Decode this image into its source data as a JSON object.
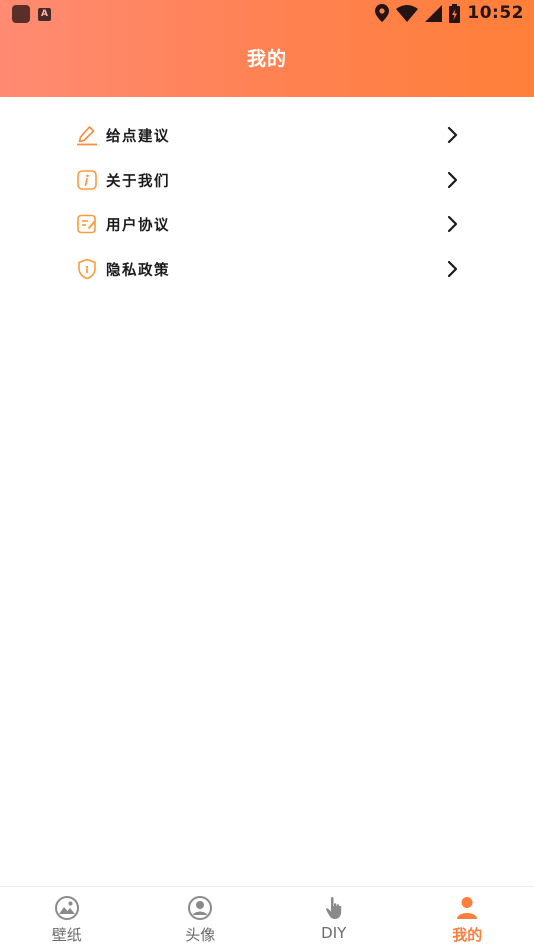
{
  "status_bar": {
    "time": "10:52",
    "app_badge": "A"
  },
  "header": {
    "title": "我的"
  },
  "menu": {
    "items": [
      {
        "label": "给点建议",
        "icon": "pencil-icon"
      },
      {
        "label": "关于我们",
        "icon": "info-icon"
      },
      {
        "label": "用户协议",
        "icon": "document-edit-icon"
      },
      {
        "label": "隐私政策",
        "icon": "shield-icon"
      }
    ]
  },
  "tabbar": {
    "tabs": [
      {
        "label": "壁纸",
        "icon": "wallpaper-icon",
        "active": false
      },
      {
        "label": "头像",
        "icon": "avatar-icon",
        "active": false
      },
      {
        "label": "DIY",
        "icon": "hand-pointer-icon",
        "active": false
      },
      {
        "label": "我的",
        "icon": "person-icon",
        "active": true
      }
    ]
  },
  "colors": {
    "accent": "#ff7e3e",
    "header_start": "#ff8b72",
    "header_end": "#ff8038",
    "inactive_tab": "#6b6b6b"
  }
}
